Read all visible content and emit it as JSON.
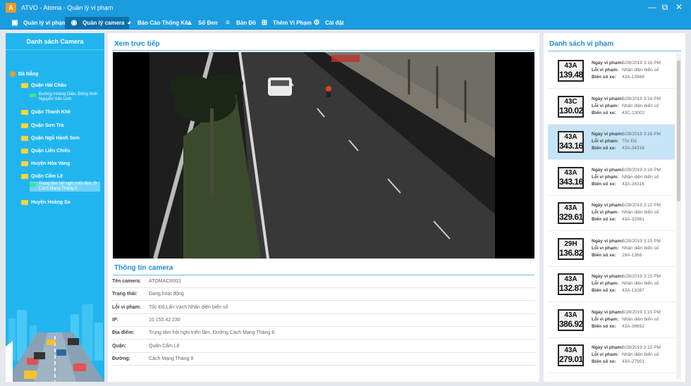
{
  "app": {
    "logo_text": "A",
    "title": "ATVO - Atoma - Quản lý vi phạm"
  },
  "nav": {
    "items": [
      {
        "label": "Quản lý vi phạm",
        "icon": "car-icon"
      },
      {
        "label": "Quản lý camera",
        "icon": "camera-icon"
      },
      {
        "label": "Báo Cáo Thống Kê",
        "icon": "pie-chart-icon"
      },
      {
        "label": "Sổ Đen",
        "icon": "warning-icon"
      },
      {
        "label": "Bản Đồ",
        "icon": "map-icon"
      },
      {
        "label": "Thêm Vi Phạm",
        "icon": "plus-icon"
      },
      {
        "label": "Cài đặt",
        "icon": "gear-icon"
      }
    ],
    "active_index": 1
  },
  "sidebar": {
    "title": "Danh sách Camera",
    "tree": [
      {
        "label": "Đà Nẵng",
        "type": "root"
      },
      {
        "label": "Quận Hải Châu",
        "type": "folder"
      },
      {
        "label": "Đường Hoàng Diệu, Đông bình Nguyễn Văn Linh",
        "type": "camera"
      },
      {
        "label": "Quận Thanh Khê",
        "type": "folder"
      },
      {
        "label": "Quận Sơn Trà",
        "type": "folder"
      },
      {
        "label": "Quận Ngũ Hành Sơn",
        "type": "folder"
      },
      {
        "label": "Quận Liên Chiểu",
        "type": "folder"
      },
      {
        "label": "Huyện Hòa Vang",
        "type": "folder"
      },
      {
        "label": "Quận Cẩm Lệ",
        "type": "folder"
      },
      {
        "label": "Trung tâm hội nghị triển lãm, Đ Cách Mạng Tháng 8",
        "type": "camera",
        "selected": true
      },
      {
        "label": "Huyện Hoàng Sa",
        "type": "folder"
      }
    ]
  },
  "live": {
    "title": "Xem trực tiếp"
  },
  "camera_info": {
    "title": "Thông tin camera",
    "rows": [
      {
        "label": "Tên camera:",
        "value": "ATOMACR001"
      },
      {
        "label": "Trạng thái:",
        "value": "Đang hoạt động"
      },
      {
        "label": "Lỗi vi phạm:",
        "value": "Tốc Độ;Lấn Vạch;Nhận diện biển số"
      },
      {
        "label": "IP:",
        "value": "10.155.42.230"
      },
      {
        "label": "Địa điểm:",
        "value": "Trung tâm hội nghị triển lãm, Đường Cách Mạng Tháng 8"
      },
      {
        "label": "Quận:",
        "value": "Quận Cẩm Lệ"
      },
      {
        "label": "Đường:",
        "value": "Cách Mạng Tháng 8"
      }
    ]
  },
  "violations": {
    "title": "Danh sách vi phạm",
    "labels": {
      "date": "Ngày vi phạm:",
      "error": "Lỗi vi phạm:",
      "plate": "Biển số xe:"
    },
    "items": [
      {
        "plate_top": "43A",
        "plate_bottom": "139.48",
        "date": "6/28/2019 3:16 PM",
        "error": "Nhận diện biển số",
        "plate": "43A-13948"
      },
      {
        "plate_top": "43C",
        "plate_bottom": "130.02",
        "date": "6/28/2019 3:16 PM",
        "error": "Nhận diện biển số",
        "plate": "43C-13002"
      },
      {
        "plate_top": "43A",
        "plate_bottom": "343.16",
        "date": "6/28/2019 3:16 PM",
        "error": "Tốc Độ",
        "plate": "43A-34316",
        "selected": true
      },
      {
        "plate_top": "43A",
        "plate_bottom": "343.16",
        "date": "6/28/2019 3:16 PM",
        "error": "Nhận diện biển số",
        "plate": "43A-34316"
      },
      {
        "plate_top": "43A",
        "plate_bottom": "329.61",
        "date": "6/28/2019 3:15 PM",
        "error": "Nhận diện biển số",
        "plate": "43A-32961"
      },
      {
        "plate_top": "29H",
        "plate_bottom": "136.82",
        "date": "6/28/2019 3:15 PM",
        "error": "Nhận diện biển số",
        "plate": "29A-1368"
      },
      {
        "plate_top": "43A",
        "plate_bottom": "132.87",
        "date": "6/28/2019 3:15 PM",
        "error": "Nhận diện biển số",
        "plate": "43A-13287"
      },
      {
        "plate_top": "43A",
        "plate_bottom": "386.92",
        "date": "6/28/2019 3:15 PM",
        "error": "Nhận diện biển số",
        "plate": "43A-38692"
      },
      {
        "plate_top": "43A",
        "plate_bottom": "279.01",
        "date": "6/28/2019 3:15 PM",
        "error": "Nhận diện biển số",
        "plate": "43A-27901"
      }
    ]
  },
  "colors": {
    "primary": "#1a9ce0",
    "sidebar": "#21b5ef",
    "selected_row": "#c5e4f7",
    "title_text": "#1b8ed1"
  }
}
